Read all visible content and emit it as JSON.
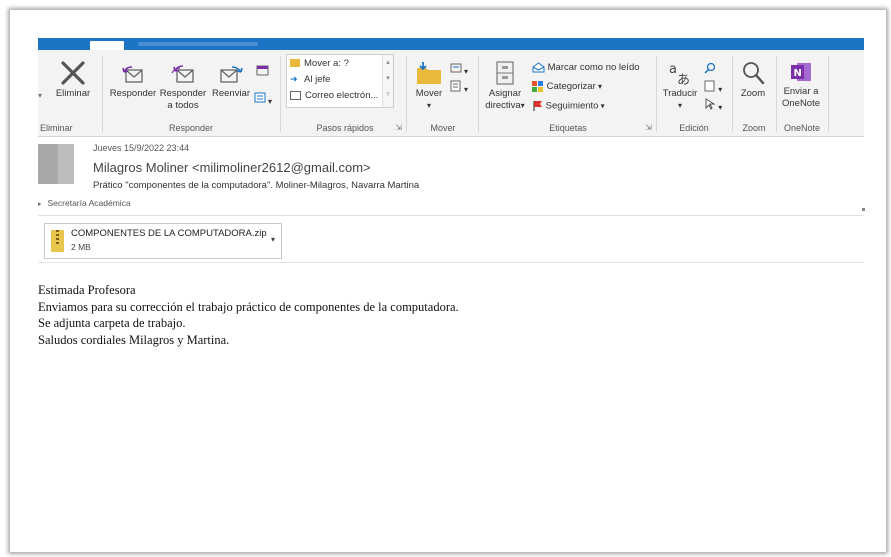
{
  "ribbon": {
    "delete_group": {
      "button": "Eliminar",
      "label": "Eliminar"
    },
    "respond_group": {
      "reply": "Responder",
      "reply_all_line1": "Responder",
      "reply_all_line2": "a todos",
      "forward": "Reenviar",
      "label": "Responder"
    },
    "quick_steps": {
      "items": [
        "Mover a: ?",
        "Al jefe",
        "Correo electrón..."
      ],
      "label": "Pasos rápidos"
    },
    "move_group": {
      "button": "Mover",
      "label": "Mover"
    },
    "tags_group": {
      "assign_line1": "Asignar",
      "assign_line2": "directiva",
      "mark_unread": "Marcar como no leído",
      "categorize": "Categorizar",
      "followup": "Seguimiento",
      "label": "Etiquetas"
    },
    "edit_group": {
      "translate": "Traducir",
      "label": "Edición"
    },
    "zoom_group": {
      "button": "Zoom",
      "label": "Zoom"
    },
    "onenote_group": {
      "line1": "Enviar a",
      "line2": "OneNote",
      "label": "OneNote"
    }
  },
  "message": {
    "date": "Jueves 15/9/2022 23:44",
    "from": "Milagros Moliner <milimoliner2612@gmail.com>",
    "subject": "Prático \"componentes de la computadora\". Moliner-Milagros, Navarra Martina",
    "folder": "Secretaría Académica",
    "attachment": {
      "name": "COMPONENTES DE LA COMPUTADORA.zip",
      "size": "2 MB"
    },
    "body_lines": [
      "Estimada Profesora",
      "Enviamos para su corrección el trabajo práctico de componentes de la computadora.",
      "Se adjunta carpeta de trabajo.",
      "Saludos cordiales Milagros y Martina."
    ]
  },
  "colors": {
    "titlebar": "#1d73c4",
    "ribbon": "#f3f3f3",
    "accent_purple": "#7b2fa8"
  }
}
